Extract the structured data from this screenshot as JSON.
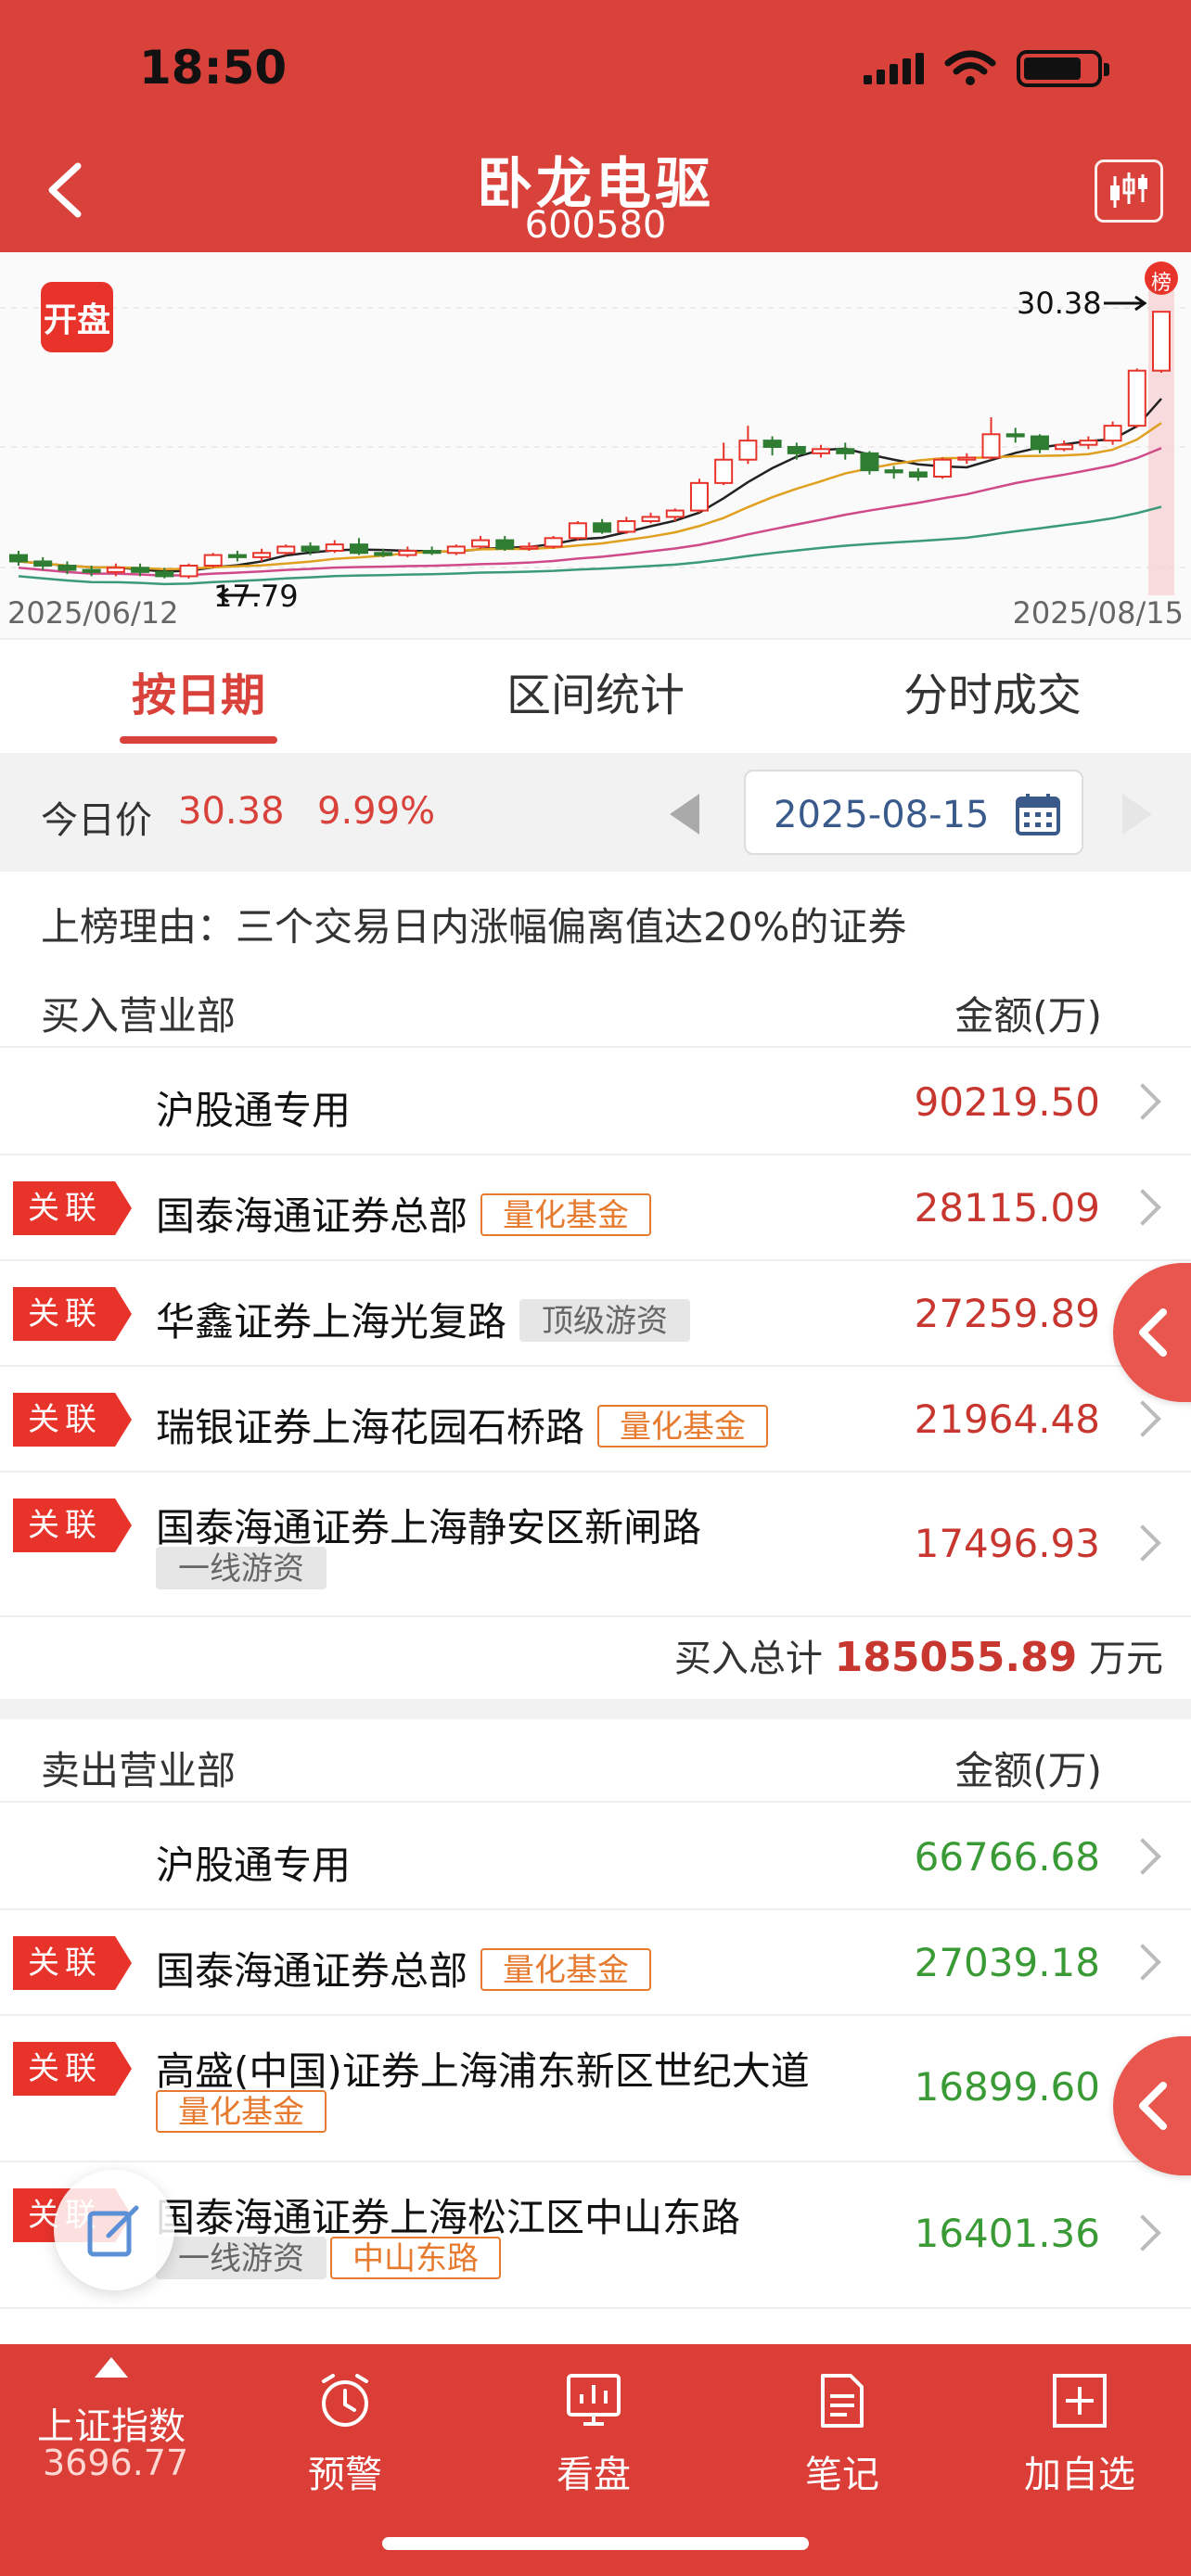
{
  "status": {
    "time": "18:50"
  },
  "header": {
    "name": "卧龙电驱",
    "code": "600580"
  },
  "chart": {
    "badge": "开盘",
    "start_date": "2025/06/12",
    "end_date": "2025/08/15",
    "high_label": "30.38",
    "low_label": "17.79",
    "rank_marker": "榜",
    "colors": {
      "up": "#e8332b",
      "down": "#2f7d32",
      "ma5": "#222222",
      "ma10": "#e0a020",
      "ma20": "#d04a8a",
      "ma60": "#3a9a7a"
    }
  },
  "chart_data": {
    "type": "candlestick",
    "x_start": "2025/06/12",
    "x_end": "2025/08/15",
    "ylim": [
      17,
      31
    ],
    "candles": [
      {
        "o": 18.9,
        "c": 18.6,
        "h": 19.1,
        "l": 18.4
      },
      {
        "o": 18.6,
        "c": 18.4,
        "h": 18.8,
        "l": 18.2
      },
      {
        "o": 18.4,
        "c": 18.2,
        "h": 18.6,
        "l": 18.0
      },
      {
        "o": 18.2,
        "c": 18.1,
        "h": 18.4,
        "l": 17.9
      },
      {
        "o": 18.1,
        "c": 18.3,
        "h": 18.5,
        "l": 17.9
      },
      {
        "o": 18.3,
        "c": 18.1,
        "h": 18.5,
        "l": 17.9
      },
      {
        "o": 18.1,
        "c": 17.9,
        "h": 18.3,
        "l": 17.8
      },
      {
        "o": 17.9,
        "c": 18.4,
        "h": 18.5,
        "l": 17.79
      },
      {
        "o": 18.4,
        "c": 18.9,
        "h": 19.0,
        "l": 18.3
      },
      {
        "o": 18.9,
        "c": 18.8,
        "h": 19.1,
        "l": 18.6
      },
      {
        "o": 18.8,
        "c": 19.0,
        "h": 19.2,
        "l": 18.6
      },
      {
        "o": 19.0,
        "c": 19.3,
        "h": 19.4,
        "l": 18.9
      },
      {
        "o": 19.3,
        "c": 19.1,
        "h": 19.5,
        "l": 18.9
      },
      {
        "o": 19.1,
        "c": 19.4,
        "h": 19.6,
        "l": 19.0
      },
      {
        "o": 19.4,
        "c": 19.0,
        "h": 19.7,
        "l": 18.9
      },
      {
        "o": 19.0,
        "c": 18.9,
        "h": 19.2,
        "l": 18.8
      },
      {
        "o": 18.9,
        "c": 19.1,
        "h": 19.3,
        "l": 18.8
      },
      {
        "o": 19.1,
        "c": 19.0,
        "h": 19.3,
        "l": 18.9
      },
      {
        "o": 19.0,
        "c": 19.3,
        "h": 19.4,
        "l": 18.9
      },
      {
        "o": 19.3,
        "c": 19.6,
        "h": 19.8,
        "l": 19.2
      },
      {
        "o": 19.6,
        "c": 19.2,
        "h": 19.8,
        "l": 19.1
      },
      {
        "o": 19.2,
        "c": 19.3,
        "h": 19.5,
        "l": 19.1
      },
      {
        "o": 19.3,
        "c": 19.7,
        "h": 19.8,
        "l": 19.2
      },
      {
        "o": 19.7,
        "c": 20.4,
        "h": 20.5,
        "l": 19.6
      },
      {
        "o": 20.4,
        "c": 20.0,
        "h": 20.6,
        "l": 19.9
      },
      {
        "o": 20.0,
        "c": 20.5,
        "h": 20.7,
        "l": 19.9
      },
      {
        "o": 20.5,
        "c": 20.7,
        "h": 20.9,
        "l": 20.4
      },
      {
        "o": 20.7,
        "c": 21.0,
        "h": 21.1,
        "l": 20.5
      },
      {
        "o": 21.0,
        "c": 22.3,
        "h": 22.5,
        "l": 20.9
      },
      {
        "o": 22.3,
        "c": 23.4,
        "h": 24.2,
        "l": 22.2
      },
      {
        "o": 23.4,
        "c": 24.3,
        "h": 25.0,
        "l": 23.2
      },
      {
        "o": 24.3,
        "c": 24.0,
        "h": 24.5,
        "l": 23.6
      },
      {
        "o": 24.0,
        "c": 23.7,
        "h": 24.2,
        "l": 23.4
      },
      {
        "o": 23.7,
        "c": 23.9,
        "h": 24.1,
        "l": 23.5
      },
      {
        "o": 23.9,
        "c": 23.7,
        "h": 24.2,
        "l": 23.4
      },
      {
        "o": 23.7,
        "c": 22.9,
        "h": 23.8,
        "l": 22.7
      },
      {
        "o": 22.9,
        "c": 22.8,
        "h": 23.1,
        "l": 22.5
      },
      {
        "o": 22.8,
        "c": 22.6,
        "h": 23.0,
        "l": 22.4
      },
      {
        "o": 22.6,
        "c": 23.4,
        "h": 23.5,
        "l": 22.5
      },
      {
        "o": 23.4,
        "c": 23.5,
        "h": 23.7,
        "l": 23.2
      },
      {
        "o": 23.5,
        "c": 24.6,
        "h": 25.4,
        "l": 23.4
      },
      {
        "o": 24.6,
        "c": 24.5,
        "h": 24.9,
        "l": 24.2
      },
      {
        "o": 24.5,
        "c": 23.9,
        "h": 24.6,
        "l": 23.7
      },
      {
        "o": 23.9,
        "c": 24.1,
        "h": 24.3,
        "l": 23.8
      },
      {
        "o": 24.1,
        "c": 24.3,
        "h": 24.5,
        "l": 23.9
      },
      {
        "o": 24.3,
        "c": 25.0,
        "h": 25.2,
        "l": 24.1
      },
      {
        "o": 25.0,
        "c": 27.6,
        "h": 27.7,
        "l": 24.9
      },
      {
        "o": 27.6,
        "c": 30.38,
        "h": 30.38,
        "l": 27.5
      }
    ]
  },
  "tabs": [
    {
      "label": "按日期",
      "active": true
    },
    {
      "label": "区间统计",
      "active": false
    },
    {
      "label": "分时成交",
      "active": false
    }
  ],
  "price_bar": {
    "label": "今日价",
    "price": "30.38",
    "change": "9.99%",
    "date": "2025-08-15"
  },
  "reason": "上榜理由：三个交易日内涨幅偏离值达20%的证券",
  "buy": {
    "title": "买入营业部",
    "amount_header": "金额(万)",
    "rows": [
      {
        "name": "沪股通专用",
        "related": false,
        "badges": [],
        "amount": "90219.50"
      },
      {
        "name": "国泰海通证券总部",
        "related": true,
        "badges": [
          {
            "text": "量化基金",
            "style": "orange"
          }
        ],
        "amount": "28115.09"
      },
      {
        "name": "华鑫证券上海光复路",
        "related": true,
        "badges": [
          {
            "text": "顶级游资",
            "style": "gray"
          }
        ],
        "amount": "27259.89"
      },
      {
        "name": "瑞银证券上海花园石桥路",
        "related": true,
        "badges": [
          {
            "text": "量化基金",
            "style": "orange"
          }
        ],
        "amount": "21964.48"
      },
      {
        "name": "国泰海通证券上海静安区新闸路",
        "related": true,
        "badges": [
          {
            "text": "一线游资",
            "style": "gray"
          }
        ],
        "amount": "17496.93"
      }
    ],
    "total_label": "买入总计",
    "total_value": "185055.89",
    "total_unit": "万元"
  },
  "sell": {
    "title": "卖出营业部",
    "amount_header": "金额(万)",
    "rows": [
      {
        "name": "沪股通专用",
        "related": false,
        "badges": [],
        "amount": "66766.68"
      },
      {
        "name": "国泰海通证券总部",
        "related": true,
        "badges": [
          {
            "text": "量化基金",
            "style": "orange"
          }
        ],
        "amount": "27039.18"
      },
      {
        "name": "高盛(中国)证券上海浦东新区世纪大道",
        "related": true,
        "badges": [
          {
            "text": "量化基金",
            "style": "orange"
          }
        ],
        "amount": "16899.60"
      },
      {
        "name": "国泰海通证券上海松江区中山东路",
        "related": true,
        "badges": [
          {
            "text": "一线游资",
            "style": "gray"
          },
          {
            "text": "中山东路",
            "style": "orange"
          }
        ],
        "amount": "16401.36"
      }
    ]
  },
  "related_label": "关联",
  "bottom_nav": {
    "index_name": "上证指数",
    "index_value": "3696.77",
    "items": [
      "预警",
      "看盘",
      "笔记",
      "加自选"
    ]
  }
}
